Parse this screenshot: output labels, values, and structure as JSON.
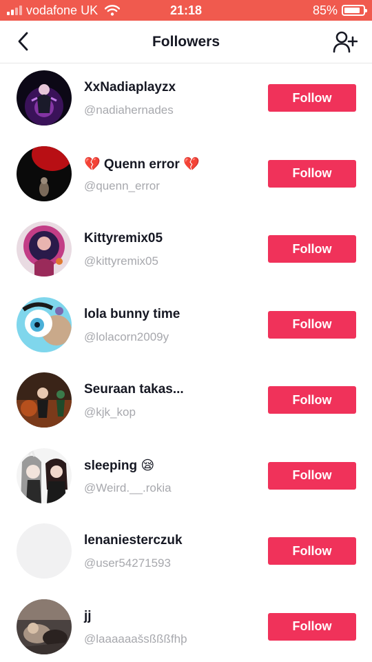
{
  "status_bar": {
    "carrier": "vodafone UK",
    "time": "21:18",
    "battery": "85%",
    "battery_level": 0.85
  },
  "header": {
    "title": "Followers",
    "back_icon": "chevron-left-icon",
    "add_icon": "add-user-icon"
  },
  "colors": {
    "status_bar": "#f05a4e",
    "follow_button": "#f0325a",
    "handle_text": "#a7a8ad"
  },
  "followers": [
    {
      "name": "XxNadiaplayzx",
      "handle": "@nadiahernades",
      "button": "Follow"
    },
    {
      "name": "💔 Quenn error 💔",
      "handle": "@quenn_error",
      "button": "Follow"
    },
    {
      "name": "Kittyremix05",
      "handle": "@kittyremix05",
      "button": "Follow"
    },
    {
      "name": "lola bunny time",
      "handle": "@lolacorn2009y",
      "button": "Follow"
    },
    {
      "name": "Seuraan takas...",
      "handle": "@kjk_kop",
      "button": "Follow"
    },
    {
      "name": "sleeping 😪",
      "handle": "@Weird.__.rokia",
      "button": "Follow"
    },
    {
      "name": "lenaniesterczuk",
      "handle": "@user54271593",
      "button": "Follow"
    },
    {
      "name": "jj",
      "handle": "@laaaaaašsßßßfhþ",
      "button": "Follow"
    }
  ]
}
